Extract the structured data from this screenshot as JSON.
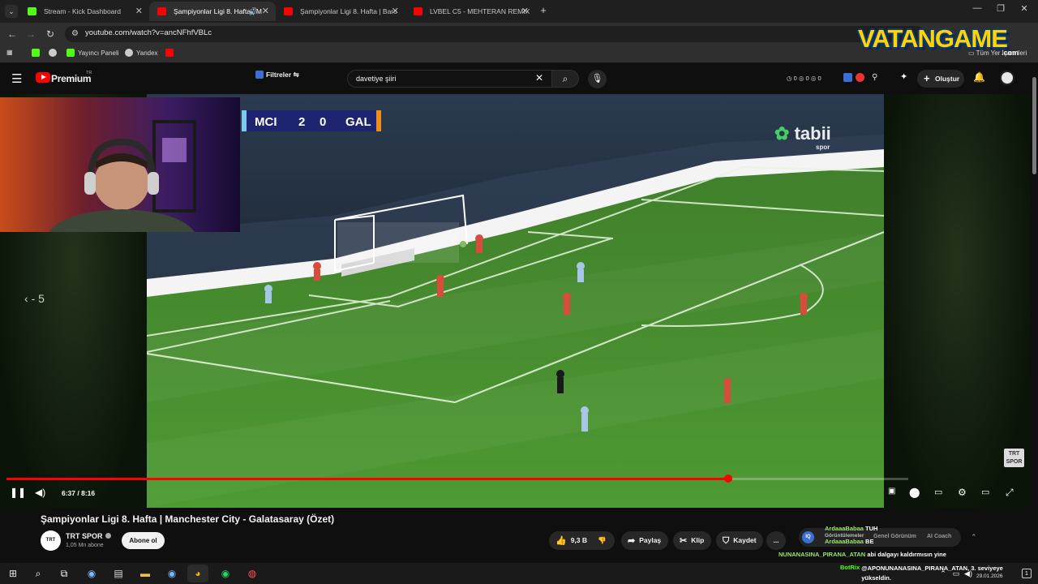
{
  "browser": {
    "tabs": [
      {
        "title": "Stream - Kick Dashboard",
        "favicon_color": "#53fc18",
        "active": false
      },
      {
        "title": "Şampiyonlar Ligi 8. Hafta | M",
        "favicon_color": "#ff0000",
        "active": true
      },
      {
        "title": "Şampiyonlar Ligi 8. Hafta | Barc",
        "favicon_color": "#ff0000",
        "active": false
      },
      {
        "title": "LVBEL C5 - MEHTERAN REMIX",
        "favicon_color": "#ff0000",
        "active": false
      }
    ],
    "url": "youtube.com/watch?v=ancNFhfVBLc",
    "bookmarks": [
      {
        "label": "Yayıncı Paneli",
        "icon_color": "#53fc18"
      },
      {
        "label": "Yandex",
        "icon_color": "#cccccc"
      }
    ],
    "all_bookmarks": "Tüm Yer İşaretleri"
  },
  "watermark": {
    "text": "VATANGAME",
    "suffix": ".com"
  },
  "youtube": {
    "logo_text": "Premium",
    "region": "TR",
    "filters_label": "Filtreler",
    "search_value": "davetiye şiiri",
    "ext_counts": [
      "0",
      "0",
      "0"
    ],
    "create_label": "Oluştur"
  },
  "player": {
    "current_time": "6:37",
    "duration": "8:16",
    "progress": 0.8,
    "seek_back_label": "- 5",
    "scoreboard": {
      "home": "MCI",
      "home_score": "2",
      "away_score": "0",
      "away": "GAL"
    },
    "broadcaster": "tabii",
    "broadcaster_sub": "spor",
    "corner_logo": "TRT SPOR"
  },
  "video": {
    "title": "Şampiyonlar Ligi 8. Hafta | Manchester City - Galatasaray (Özet)",
    "channel": "TRT SPOR",
    "subscribers": "1,05 Mn abone",
    "subscribe_label": "Abone ol",
    "likes": "9,3 B",
    "share_label": "Paylaş",
    "clip_label": "Klip",
    "save_label": "Kaydet",
    "more_label": "...",
    "side_tabs": [
      "Genel Görünüm",
      "AI Coach"
    ]
  },
  "chat": [
    {
      "user": "ArdaaaBabaa",
      "text": "TUH",
      "color": "#9be36b"
    },
    {
      "user": "Görüntülemeler",
      "text": "",
      "color": "#bbbbbb"
    },
    {
      "user": "ArdaaaBabaa",
      "text": "BE",
      "color": "#9be36b"
    },
    {
      "user": "NUNANASINA_PIRANA_ATAN",
      "text": "abi dalgayı kaldırmısın yine",
      "color": "#9be36b"
    },
    {
      "user": "BotRix",
      "text": "@APONUNANASINA_PIRANA_ATAN, 3. seviyeye yükseldin.",
      "color": "#53fc18"
    }
  ],
  "taskbar": {
    "date": "29.01.2026",
    "notif_count": "1"
  }
}
